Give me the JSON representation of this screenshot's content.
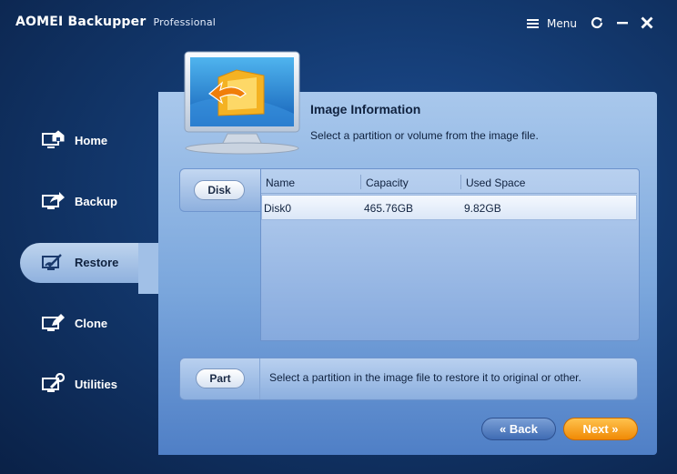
{
  "app": {
    "title": "AOMEI Backupper",
    "edition": "Professional",
    "menu_label": "Menu"
  },
  "window_controls": {
    "refresh_icon": "refresh-icon",
    "minimize_icon": "minimize-icon",
    "close_icon": "close-icon"
  },
  "sidebar": {
    "items": [
      {
        "label": "Home",
        "icon": "home-icon",
        "active": false
      },
      {
        "label": "Backup",
        "icon": "backup-icon",
        "active": false
      },
      {
        "label": "Restore",
        "icon": "restore-icon",
        "active": true
      },
      {
        "label": "Clone",
        "icon": "clone-icon",
        "active": false
      },
      {
        "label": "Utilities",
        "icon": "utilities-icon",
        "active": false
      }
    ]
  },
  "panel": {
    "title": "Image Information",
    "subtitle": "Select a partition or volume from the image file."
  },
  "disk": {
    "button_label": "Disk",
    "columns": [
      "Name",
      "Capacity",
      "Used Space"
    ],
    "rows": [
      {
        "name": "Disk0",
        "capacity": "465.76GB",
        "used": "9.82GB"
      }
    ]
  },
  "part": {
    "button_label": "Part",
    "description": "Select a partition in the image file to restore it to original or other."
  },
  "footer": {
    "back_label": "Back",
    "next_label": "Next"
  },
  "colors": {
    "next_accent": "#f08a05",
    "back_accent": "#3f6bb3",
    "panel": "#a9c8ec"
  }
}
